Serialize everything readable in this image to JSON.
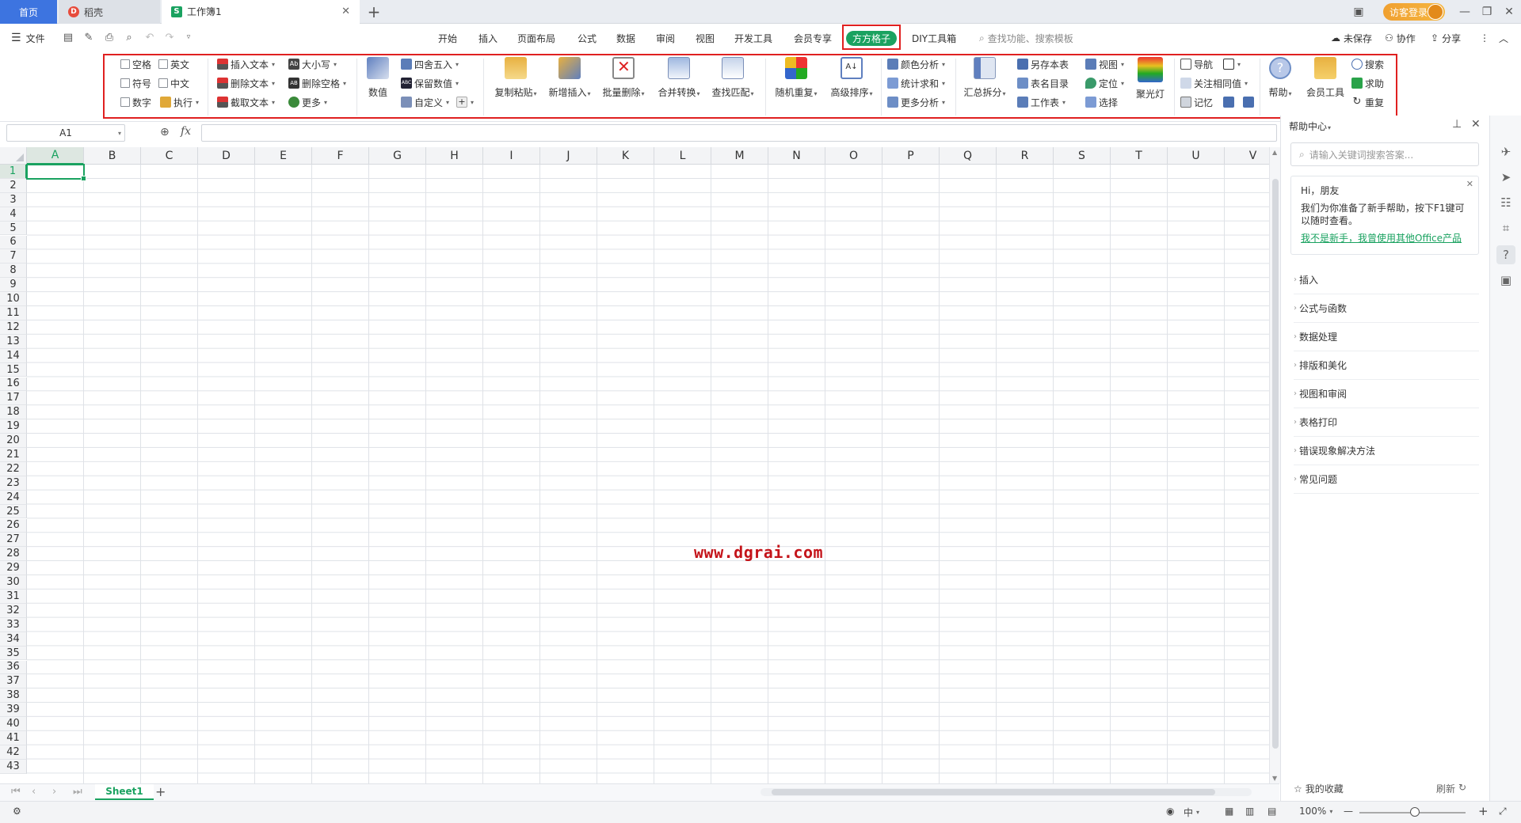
{
  "tabs": {
    "home": "首页",
    "doc": "稻壳",
    "workbook": "工作簿1",
    "login": "访客登录"
  },
  "menubar": {
    "file": "文件",
    "ribbon_tabs": [
      "开始",
      "插入",
      "页面布局",
      "公式",
      "数据",
      "审阅",
      "视图",
      "开发工具",
      "会员专享",
      "方方格子",
      "DIY工具箱"
    ],
    "active_tab": "方方格子",
    "search_placeholder": "查找功能、搜索模板",
    "unsaved": "未保存",
    "collab": "协作",
    "share": "分享"
  },
  "ribbon": {
    "checks": [
      "空格",
      "英文",
      "符号",
      "中文",
      "数字"
    ],
    "execute": "执行",
    "text_ops": [
      "插入文本",
      "删除文本",
      "截取文本"
    ],
    "case_ops": [
      "大小写",
      "删除空格",
      "更多"
    ],
    "numeric": "数值",
    "num_ops": [
      "四舍五入",
      "保留数值",
      "自定义"
    ],
    "big1": [
      "复制粘贴",
      "新增插入",
      "批量删除",
      "合并转换",
      "查找匹配",
      "随机重复",
      "高级排序"
    ],
    "analysis": [
      "颜色分析",
      "统计求和",
      "更多分析"
    ],
    "summary_split": "汇总拆分",
    "sheet_ops": [
      "另存本表",
      "表名目录",
      "工作表"
    ],
    "view_ops": [
      "视图",
      "定位",
      "选择"
    ],
    "spotlight": "聚光灯",
    "nav_ops": [
      "导航",
      "关注相同值",
      "记忆"
    ],
    "help": "帮助",
    "vip_tools": "会员工具",
    "right_ops": [
      "搜索",
      "求助",
      "重复"
    ]
  },
  "formula_bar": {
    "name_box": "A1",
    "fx": "fx"
  },
  "grid": {
    "columns": [
      "A",
      "B",
      "C",
      "D",
      "E",
      "F",
      "G",
      "H",
      "I",
      "J",
      "K",
      "L",
      "M",
      "N",
      "O",
      "P",
      "Q",
      "R",
      "S",
      "T",
      "U",
      "V"
    ],
    "rows": [
      "1",
      "2",
      "3",
      "4",
      "5",
      "6",
      "7",
      "8",
      "9",
      "10",
      "11",
      "12",
      "13",
      "14",
      "15",
      "16",
      "17",
      "18",
      "19",
      "20",
      "21",
      "22",
      "23",
      "24",
      "25",
      "26",
      "27",
      "28",
      "29",
      "30",
      "31",
      "32",
      "33",
      "34",
      "35",
      "36",
      "37",
      "38",
      "39",
      "40",
      "41",
      "42",
      "43"
    ],
    "active_cell": "A1",
    "watermark": "www.dgrai.com"
  },
  "sheets": {
    "tabs": [
      "Sheet1"
    ]
  },
  "status": {
    "zoom": "100%",
    "lang": "中"
  },
  "help_panel": {
    "title": "帮助中心",
    "search_placeholder": "请输入关键词搜索答案...",
    "greeting": "Hi，朋友",
    "intro": "我们为你准备了新手帮助，按下F1键可以随时查看。",
    "link": "我不是新手，我曾使用其他Office产品",
    "sections": [
      "插入",
      "公式与函数",
      "数据处理",
      "排版和美化",
      "视图和审阅",
      "表格打印",
      "错误现象解决方法",
      "常见问题"
    ],
    "favorites": "我的收藏",
    "refresh": "刷新"
  }
}
